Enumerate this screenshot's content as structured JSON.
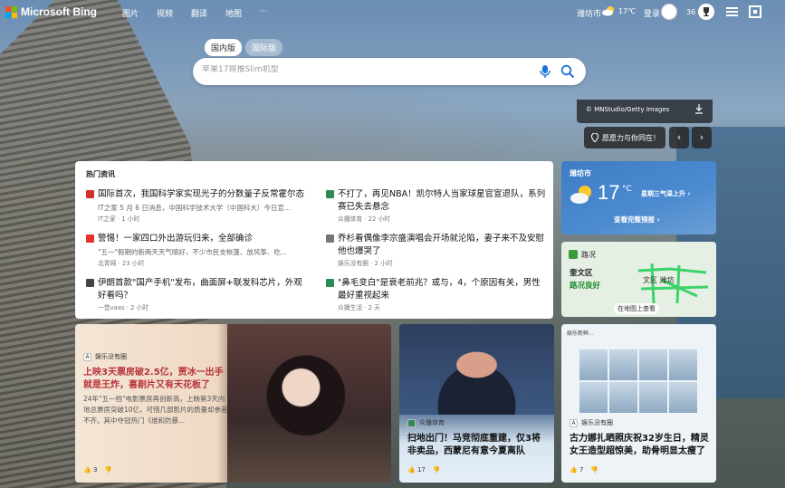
{
  "header": {
    "logo_text": "Microsoft Bing",
    "nav": [
      "图片",
      "视频",
      "翻译",
      "地图",
      "···"
    ],
    "city": "潍坊市",
    "temp": "17℃",
    "login": "登录",
    "points": "36"
  },
  "search": {
    "tabs": [
      "国内版",
      "国际版"
    ],
    "placeholder": "苹果17将推Slim机型"
  },
  "background": {
    "credit": "© MNStudio/Getty Images",
    "map_button": "愿愿力与你同在！"
  },
  "news": {
    "title": "热门资讯",
    "items": [
      {
        "headline": "国际首次，我国科学家实现光子的分数量子反常霍尔态",
        "snippet": "IT之家 5 月 6 日消息，中国科学技术大学（中国科大）今日宣...",
        "meta": "IT之家 · 1 小时",
        "icon_color": "#d0312d"
      },
      {
        "headline": "不打了，再见NBA！凯尔特人当家球星官宣退队，系列赛已失去悬念",
        "snippet": "",
        "meta": "众播体育 · 22 小时",
        "icon_color": "#2e8b57"
      },
      {
        "headline": "警惕！一家四口外出游玩归来，全部确诊",
        "snippet": "\"五一\"假期的新两天天气晴好，不少市民支帐篷、放风筝、吃...",
        "meta": "北青网 · 23 小时",
        "icon_color": "#e0342b"
      },
      {
        "headline": "乔杉看偶像李宗盛演唱会开场就沦陷，妻子来不及安慰他也爆哭了",
        "snippet": "",
        "meta": "娱乐没有圈 · 2 小时",
        "icon_color": "#777777"
      },
      {
        "headline": "伊朗首款\"国产手机\"发布，曲面屏+联发科芯片，外观好看吗？",
        "snippet": "",
        "meta": "一觉vaas · 2 小时",
        "icon_color": "#444444"
      },
      {
        "headline": "\"鼻毛变白\"是衰老前兆？或与，4，个原因有关，男性最好重视起来",
        "snippet": "",
        "meta": "众播生活 · 2 天",
        "icon_color": "#2e8b57"
      }
    ]
  },
  "weather": {
    "city": "潍坊市",
    "temp": "17",
    "unit": "°C",
    "alert": "星期三气温上升 ›",
    "more": "查看完整预报 ›"
  },
  "traffic": {
    "title": "路况",
    "area": "奎文区",
    "status": "路况良好",
    "map_label": "文区 潍坊",
    "view": "在地图上查看"
  },
  "cards": [
    {
      "source": "娱乐没有圈",
      "title": "上映3天票房破2.5亿，贾冰一出手就是王炸，喜剧片又有天花板了",
      "snippet": "24年\"五一档\"电影票房再创新高，上映第3天内地总票房突破10亿，可惜几部影片的质量却参差不齐。其中夺冠热门《维和防暴...",
      "likes": "3"
    },
    {
      "source": "众播体育",
      "title": "扫地出门！马竞彻底重建，仅3将非卖品，西蒙尼有意今夏离队",
      "snippet": "",
      "likes": "17"
    },
    {
      "source": "娱乐没有圈",
      "title": "古力娜扎晒照庆祝32岁生日，精灵女王造型超惊美，助骨明显太瘦了",
      "snippet": "",
      "likes": "7",
      "header_text": "娱乐新鲜..."
    }
  ]
}
